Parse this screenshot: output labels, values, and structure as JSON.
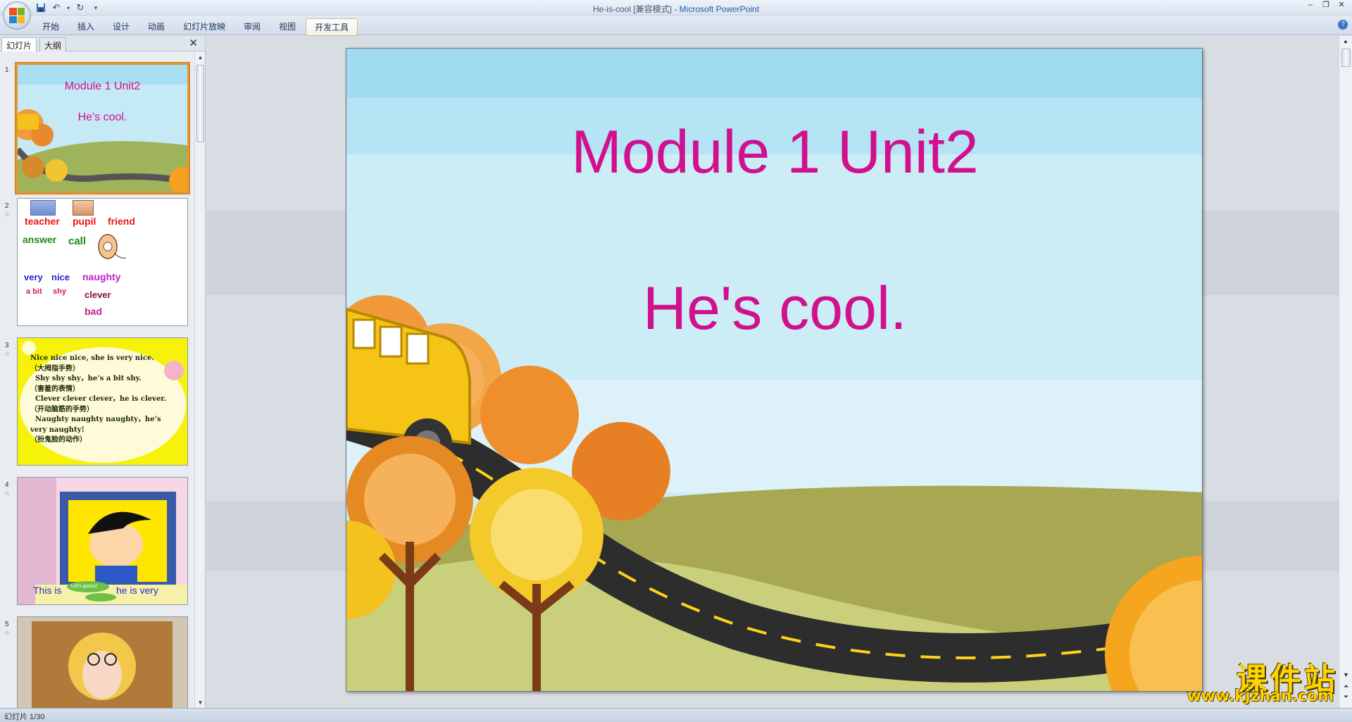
{
  "window": {
    "title_doc": "He-is-cool [兼容模式] - ",
    "title_app": "Microsoft PowerPoint"
  },
  "ribbon": {
    "tabs": [
      "开始",
      "插入",
      "设计",
      "动画",
      "幻灯片放映",
      "审阅",
      "视图",
      "开发工具"
    ],
    "active_tab": "开发工具"
  },
  "left_pane": {
    "tabs": [
      "幻灯片",
      "大纲"
    ],
    "thumbnails": [
      {
        "num": "1",
        "title": "Module 1 Unit2",
        "subtitle": "He's cool."
      },
      {
        "num": "2",
        "words": [
          "teacher",
          "pupil",
          "friend",
          "answer",
          "call",
          "very",
          "nice",
          "naughty",
          "a bit",
          "shy",
          "clever",
          "bad"
        ]
      },
      {
        "num": "3",
        "lines": "Nice nice nice, she is very nice.\n（大拇指手势）\n  Shy shy shy，he’s a bit shy.\n（害羞的表情）\n  Clever clever clever，he is clever.\n（开动脑筋的手势）\n  Naughty naughty naughty，he’s\nvery naughty!\n（扮鬼脸的动作）"
      },
      {
        "num": "4",
        "caption_left": "This is",
        "caption_right": "he is very",
        "bubble": "Let's guess!"
      },
      {
        "num": "5"
      }
    ]
  },
  "slide": {
    "title": "Module 1 Unit2",
    "subtitle": "He's cool."
  },
  "status": {
    "slide_counter": "幻灯片 1/30"
  },
  "watermark": {
    "text": "课件站",
    "url": "www.kjzhan.com"
  },
  "colors": {
    "slide_text": "#d1108d",
    "accent_orange": "#e3962e"
  }
}
